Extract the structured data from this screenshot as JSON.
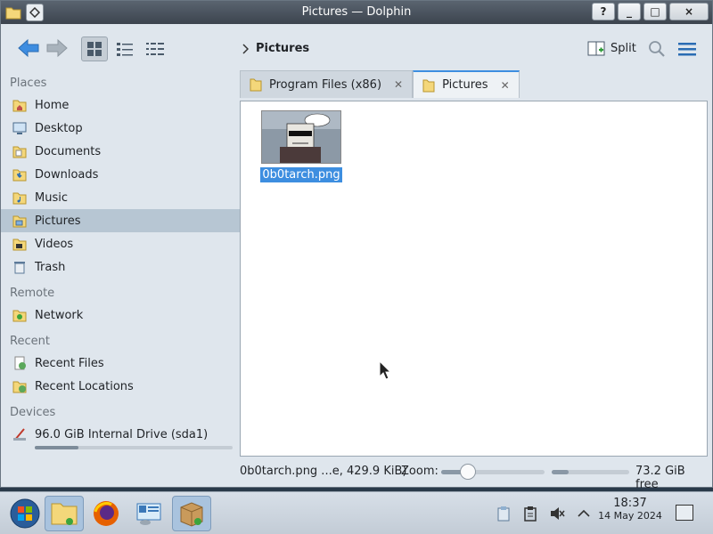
{
  "window": {
    "title": "Pictures — Dolphin"
  },
  "titlebar_buttons": {
    "help": "?",
    "minimize": "_",
    "maximize": "□",
    "close": "×"
  },
  "toolbar": {
    "breadcrumb": "Pictures",
    "split_label": "Split"
  },
  "sidebar": {
    "places_header": "Places",
    "places": [
      {
        "label": "Home",
        "icon": "home-icon"
      },
      {
        "label": "Desktop",
        "icon": "desktop-icon"
      },
      {
        "label": "Documents",
        "icon": "documents-icon"
      },
      {
        "label": "Downloads",
        "icon": "downloads-icon"
      },
      {
        "label": "Music",
        "icon": "music-icon"
      },
      {
        "label": "Pictures",
        "icon": "pictures-icon",
        "selected": true
      },
      {
        "label": "Videos",
        "icon": "videos-icon"
      },
      {
        "label": "Trash",
        "icon": "trash-icon"
      }
    ],
    "remote_header": "Remote",
    "remote": [
      {
        "label": "Network",
        "icon": "network-icon"
      }
    ],
    "recent_header": "Recent",
    "recent": [
      {
        "label": "Recent Files",
        "icon": "recent-files-icon"
      },
      {
        "label": "Recent Locations",
        "icon": "recent-locations-icon"
      }
    ],
    "devices_header": "Devices",
    "devices": [
      {
        "label": "96.0 GiB Internal Drive (sda1)",
        "icon": "drive-icon",
        "usage_fraction": 0.22
      }
    ]
  },
  "tabs": [
    {
      "label": "Program Files (x86)",
      "active": false
    },
    {
      "label": "Pictures",
      "active": true
    }
  ],
  "content": {
    "files": [
      {
        "name": "0b0tarch.png",
        "selected": true
      }
    ]
  },
  "statusbar": {
    "info": "0b0tarch.png ...e, 429.9 KiB)",
    "zoom_label": "Zoom:",
    "zoom_fraction": 0.26,
    "space_used_fraction": 0.22,
    "free": "73.2 GiB free"
  },
  "taskbar": {
    "time": "18:37",
    "date": "14 May 2024"
  },
  "colors": {
    "accent": "#3d8ee0",
    "selection": "#b7c6d3"
  }
}
